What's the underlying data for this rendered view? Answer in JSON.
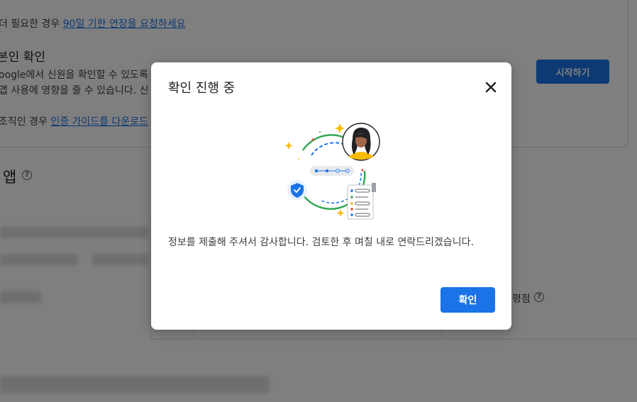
{
  "background": {
    "extension_prefix": "더 필요한 경우",
    "extension_link": "90일 기한 연장을 요청하세요",
    "section_title": "본인 확인",
    "desc_line1": "oogle에서 신원을 확인할 수 있도록",
    "desc_line2": "앱 사용에 영향을 줄 수 있습니다. 신",
    "org_prefix": "조직인 경우",
    "org_link": "인증 가이드를 다운로드",
    "start_button": "시작하기",
    "apps_heading": "앱",
    "rating_label": "평점"
  },
  "dialog": {
    "title": "확인 진행 중",
    "close_icon": "close-icon",
    "message": "정보를 제출해 주셔서 감사합니다. 검토한 후 며칠 내로 연락드리겠습니다.",
    "ok_button": "확인"
  },
  "colors": {
    "primary": "#1a73e8",
    "overlay": "rgba(0,0,0,0.5)",
    "green": "#34a853",
    "yellow": "#fbbc04",
    "red": "#ea4335"
  }
}
